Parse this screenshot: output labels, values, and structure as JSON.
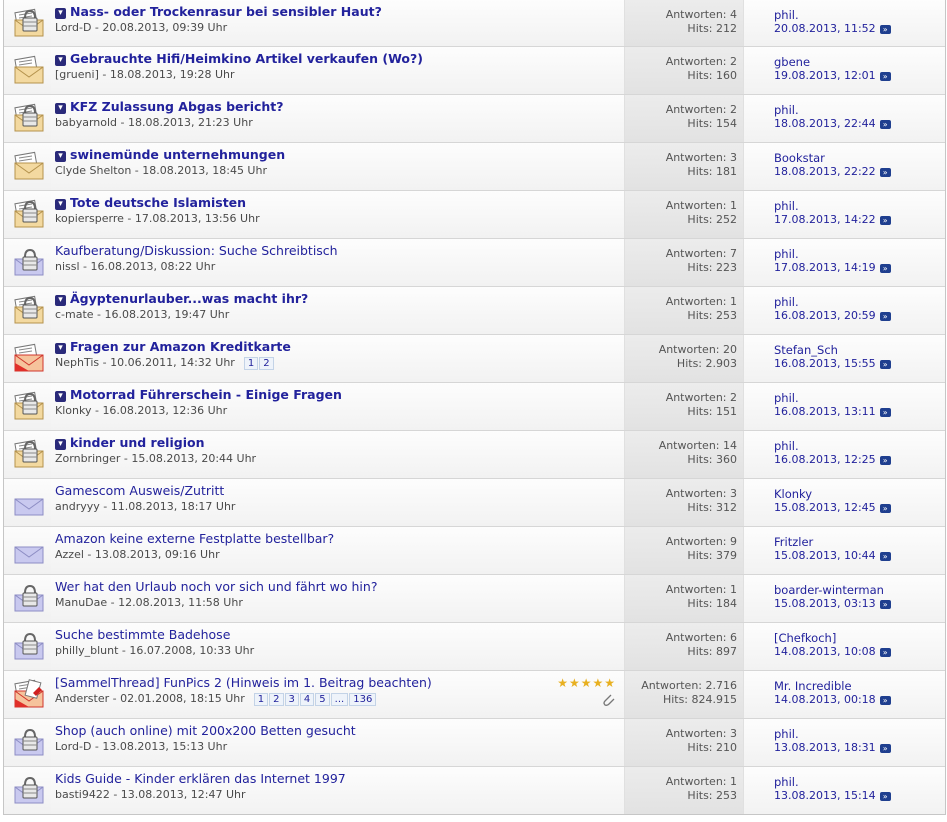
{
  "threads": [
    {
      "title": "Nass- oder Trockenrasur bei sensibler Haut?",
      "bold": true,
      "icon": "locked-thread-icon",
      "author": "Lord-D",
      "date": "20.08.2013, 09:39 Uhr",
      "replies": "Antworten: 4",
      "hits": "Hits: 212",
      "last_user": "phil.",
      "last_date": "20.08.2013, 11:52",
      "pages": []
    },
    {
      "title": "Gebrauchte Hifi/Heimkino Artikel verkaufen (Wo?)",
      "bold": true,
      "icon": "new-thread-icon",
      "author": "[grueni]",
      "date": "18.08.2013, 19:28 Uhr",
      "replies": "Antworten: 2",
      "hits": "Hits: 160",
      "last_user": "gbene",
      "last_date": "19.08.2013, 12:01",
      "pages": []
    },
    {
      "title": "KFZ Zulassung Abgas bericht?",
      "bold": true,
      "icon": "locked-thread-icon",
      "author": "babyarnold",
      "date": "18.08.2013, 21:23 Uhr",
      "replies": "Antworten: 2",
      "hits": "Hits: 154",
      "last_user": "phil.",
      "last_date": "18.08.2013, 22:44",
      "pages": []
    },
    {
      "title": "swinemünde unternehmungen",
      "bold": true,
      "icon": "new-thread-icon",
      "author": "Clyde Shelton",
      "date": "18.08.2013, 18:45 Uhr",
      "replies": "Antworten: 3",
      "hits": "Hits: 181",
      "last_user": "Bookstar",
      "last_date": "18.08.2013, 22:22",
      "pages": []
    },
    {
      "title": "Tote deutsche Islamisten",
      "bold": true,
      "icon": "locked-thread-icon",
      "author": "kopiersperre",
      "date": "17.08.2013, 13:56 Uhr",
      "replies": "Antworten: 1",
      "hits": "Hits: 252",
      "last_user": "phil.",
      "last_date": "17.08.2013, 14:22",
      "pages": []
    },
    {
      "title": "Kaufberatung/Diskussion: Suche Schreibtisch",
      "bold": false,
      "icon": "locked-read-icon",
      "author": "nissl",
      "date": "16.08.2013, 08:22 Uhr",
      "replies": "Antworten: 7",
      "hits": "Hits: 223",
      "last_user": "phil.",
      "last_date": "17.08.2013, 14:19",
      "pages": []
    },
    {
      "title": "Ägyptenurlauber...was macht ihr?",
      "bold": true,
      "icon": "locked-thread-icon",
      "author": "c-mate",
      "date": "16.08.2013, 19:47 Uhr",
      "replies": "Antworten: 1",
      "hits": "Hits: 253",
      "last_user": "phil.",
      "last_date": "16.08.2013, 20:59",
      "pages": []
    },
    {
      "title": "Fragen zur Amazon Kreditkarte",
      "bold": true,
      "icon": "hot-new-thread-icon",
      "author": "NephTis",
      "date": "10.06.2011, 14:32 Uhr",
      "replies": "Antworten: 20",
      "hits": "Hits: 2.903",
      "last_user": "Stefan_Sch",
      "last_date": "16.08.2013, 15:55",
      "pages": [
        "1",
        "2"
      ]
    },
    {
      "title": "Motorrad Führerschein - Einige Fragen",
      "bold": true,
      "icon": "locked-thread-icon",
      "author": "Klonky",
      "date": "16.08.2013, 12:36 Uhr",
      "replies": "Antworten: 2",
      "hits": "Hits: 151",
      "last_user": "phil.",
      "last_date": "16.08.2013, 13:11",
      "pages": []
    },
    {
      "title": "kinder und religion",
      "bold": true,
      "icon": "locked-thread-icon",
      "author": "Zornbringer",
      "date": "15.08.2013, 20:44 Uhr",
      "replies": "Antworten: 14",
      "hits": "Hits: 360",
      "last_user": "phil.",
      "last_date": "16.08.2013, 12:25",
      "pages": []
    },
    {
      "title": "Gamescom Ausweis/Zutritt",
      "bold": false,
      "icon": "read-thread-icon",
      "author": "andryyy",
      "date": "11.08.2013, 18:17 Uhr",
      "replies": "Antworten: 3",
      "hits": "Hits: 312",
      "last_user": "Klonky",
      "last_date": "15.08.2013, 12:45",
      "pages": []
    },
    {
      "title": "Amazon keine externe Festplatte bestellbar?",
      "bold": false,
      "icon": "read-thread-icon",
      "author": "Azzel",
      "date": "13.08.2013, 09:16 Uhr",
      "replies": "Antworten: 9",
      "hits": "Hits: 379",
      "last_user": "Fritzler",
      "last_date": "15.08.2013, 10:44",
      "pages": []
    },
    {
      "title": "Wer hat den Urlaub noch vor sich und fährt wo hin?",
      "bold": false,
      "icon": "locked-read-icon",
      "author": "ManuDae",
      "date": "12.08.2013, 11:58 Uhr",
      "replies": "Antworten: 1",
      "hits": "Hits: 184",
      "last_user": "boarder-winterman",
      "last_date": "15.08.2013, 03:13",
      "pages": []
    },
    {
      "title": "Suche bestimmte Badehose",
      "bold": false,
      "icon": "locked-read-icon",
      "author": "philly_blunt",
      "date": "16.07.2008, 10:33 Uhr",
      "replies": "Antworten: 6",
      "hits": "Hits: 897",
      "last_user": "[Chefkoch]",
      "last_date": "14.08.2013, 10:08",
      "pages": []
    },
    {
      "title": "[SammelThread] FunPics 2 (Hinweis im 1. Beitrag beachten)",
      "bold": false,
      "icon": "hot-sticky-icon",
      "author": "Anderster",
      "date": "02.01.2008, 18:15 Uhr",
      "replies": "Antworten: 2.716",
      "hits": "Hits: 824.915",
      "last_user": "Mr. Incredible",
      "last_date": "14.08.2013, 00:18",
      "pages": [
        "1",
        "2",
        "3",
        "4",
        "5",
        "...",
        "136"
      ],
      "rating": 5,
      "attachment": true
    },
    {
      "title": "Shop (auch online) mit 200x200 Betten gesucht",
      "bold": false,
      "icon": "locked-read-icon",
      "author": "Lord-D",
      "date": "13.08.2013, 15:13 Uhr",
      "replies": "Antworten: 3",
      "hits": "Hits: 210",
      "last_user": "phil.",
      "last_date": "13.08.2013, 18:31",
      "pages": []
    },
    {
      "title": "Kids Guide - Kinder erklären das Internet 1997",
      "bold": false,
      "icon": "locked-read-icon",
      "author": "basti9422",
      "date": "13.08.2013, 12:47 Uhr",
      "replies": "Antworten: 1",
      "hits": "Hits: 253",
      "last_user": "phil.",
      "last_date": "13.08.2013, 15:14",
      "pages": []
    }
  ],
  "separator": " - ",
  "colors": {
    "link": "#22229c",
    "new_icon": "#2a2a7a",
    "go_icon": "#1f3f8f",
    "star": "#e8b020"
  }
}
